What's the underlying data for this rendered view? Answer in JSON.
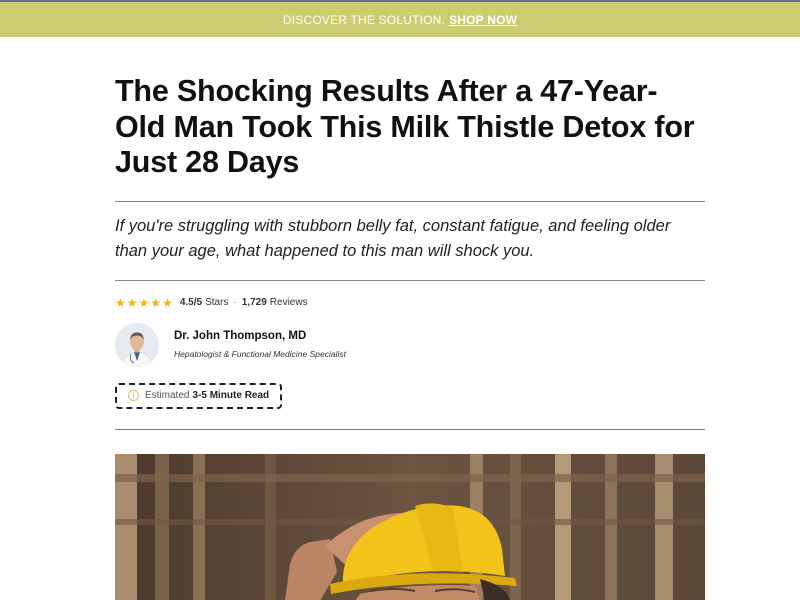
{
  "banner": {
    "text": "DISCOVER THE SOLUTION.",
    "cta": "SHOP NOW",
    "bg_color": "#cccd72"
  },
  "article": {
    "headline": "The Shocking Results After a 47-Year-Old Man Took This Milk Thistle Detox for Just 28 Days",
    "lede": "If you're struggling with stubborn belly fat, constant fatigue, and feeling older than your age, what happened to this man will shock you.",
    "rating": {
      "stars": 4.5,
      "score_text": "4.5/5",
      "score_suffix": "Stars",
      "separator": "·",
      "count_text": "1,729",
      "count_suffix": "Reviews"
    },
    "author": {
      "name": "Dr. John Thompson, MD",
      "title": "Hepatologist & Functional Medicine Specialist"
    },
    "read_time": {
      "prefix": "Estimated",
      "value": "3-5 Minute Read"
    }
  },
  "icons": {
    "star": "star-icon",
    "clock": "clock-icon"
  },
  "colors": {
    "star": "#f3b21b",
    "hard_hat": "#f2c31b"
  }
}
